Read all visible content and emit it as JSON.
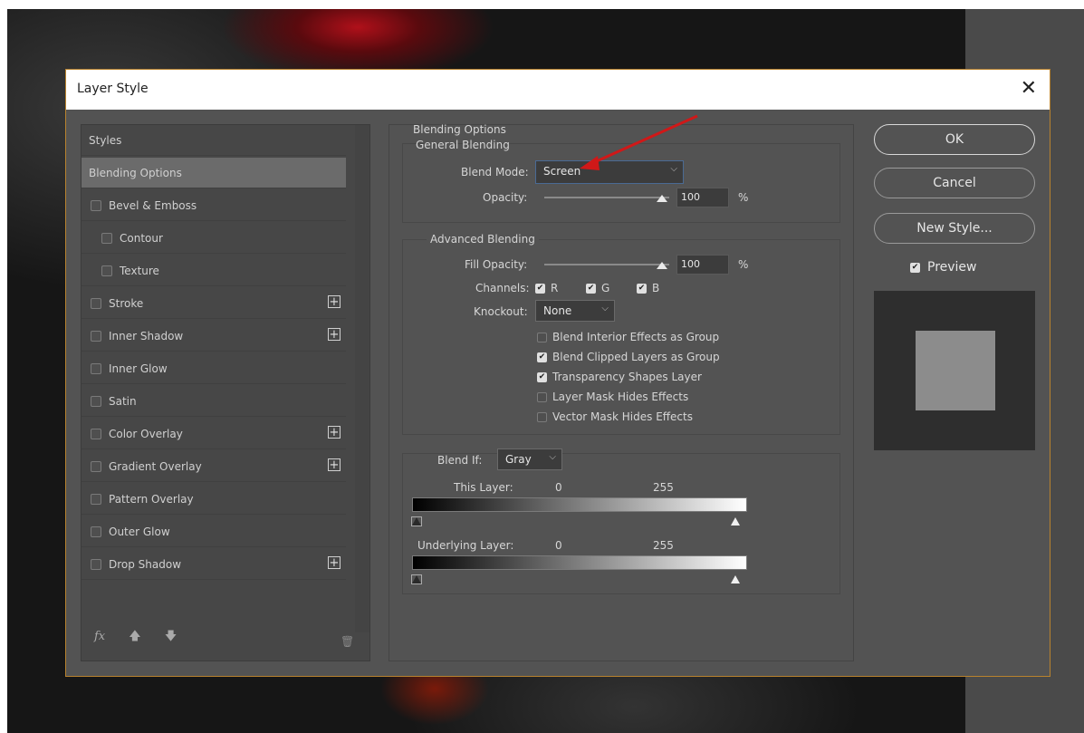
{
  "dialog": {
    "title": "Layer Style",
    "close_symbol": "✕"
  },
  "styles_panel": {
    "header": "Styles",
    "items": [
      {
        "label": "Blending Options",
        "selected": true,
        "checkbox": false,
        "plus": false,
        "indent": false
      },
      {
        "label": "Bevel & Emboss",
        "selected": false,
        "checkbox": true,
        "plus": false,
        "indent": false
      },
      {
        "label": "Contour",
        "selected": false,
        "checkbox": true,
        "plus": false,
        "indent": true
      },
      {
        "label": "Texture",
        "selected": false,
        "checkbox": true,
        "plus": false,
        "indent": true
      },
      {
        "label": "Stroke",
        "selected": false,
        "checkbox": true,
        "plus": true,
        "indent": false
      },
      {
        "label": "Inner Shadow",
        "selected": false,
        "checkbox": true,
        "plus": true,
        "indent": false
      },
      {
        "label": "Inner Glow",
        "selected": false,
        "checkbox": true,
        "plus": false,
        "indent": false
      },
      {
        "label": "Satin",
        "selected": false,
        "checkbox": true,
        "plus": false,
        "indent": false
      },
      {
        "label": "Color Overlay",
        "selected": false,
        "checkbox": true,
        "plus": true,
        "indent": false
      },
      {
        "label": "Gradient Overlay",
        "selected": false,
        "checkbox": true,
        "plus": true,
        "indent": false
      },
      {
        "label": "Pattern Overlay",
        "selected": false,
        "checkbox": true,
        "plus": false,
        "indent": false
      },
      {
        "label": "Outer Glow",
        "selected": false,
        "checkbox": true,
        "plus": false,
        "indent": false
      },
      {
        "label": "Drop Shadow",
        "selected": false,
        "checkbox": true,
        "plus": true,
        "indent": false
      }
    ],
    "bottom": {
      "fx": "fx",
      "up": "🡅",
      "down": "🡇",
      "trash": "🗑"
    }
  },
  "blending_options": {
    "title": "Blending Options",
    "general": {
      "title": "General Blending",
      "blend_mode_label": "Blend Mode:",
      "blend_mode_value": "Screen",
      "opacity_label": "Opacity:",
      "opacity_value": "100",
      "percent": "%"
    },
    "advanced": {
      "title": "Advanced Blending",
      "fill_opacity_label": "Fill Opacity:",
      "fill_opacity_value": "100",
      "percent": "%",
      "channels_label": "Channels:",
      "channels": [
        {
          "label": "R",
          "checked": true
        },
        {
          "label": "G",
          "checked": true
        },
        {
          "label": "B",
          "checked": true
        }
      ],
      "knockout_label": "Knockout:",
      "knockout_value": "None",
      "options": [
        {
          "label": "Blend Interior Effects as Group",
          "checked": false
        },
        {
          "label": "Blend Clipped Layers as Group",
          "checked": true
        },
        {
          "label": "Transparency Shapes Layer",
          "checked": true
        },
        {
          "label": "Layer Mask Hides Effects",
          "checked": false
        },
        {
          "label": "Vector Mask Hides Effects",
          "checked": false
        }
      ]
    },
    "blend_if": {
      "label": "Blend If:",
      "value": "Gray",
      "this_layer_label": "This Layer:",
      "this_layer_min": "0",
      "this_layer_max": "255",
      "underlying_label": "Underlying Layer:",
      "underlying_min": "0",
      "underlying_max": "255"
    }
  },
  "buttons": {
    "ok": "OK",
    "cancel": "Cancel",
    "new_style": "New Style...",
    "preview_label": "Preview",
    "preview_checked": true
  },
  "colors": {
    "dialog_bg": "#535353",
    "accent_border": "#b8822e",
    "arrow": "#d01818"
  }
}
